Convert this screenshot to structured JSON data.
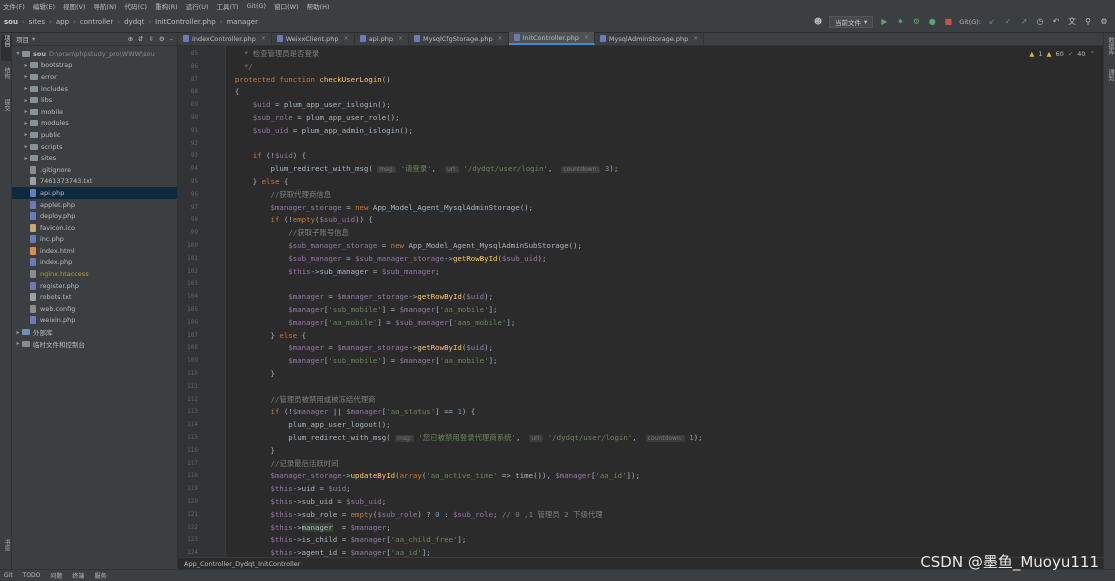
{
  "menu": [
    "文件(F)",
    "编辑(E)",
    "视图(V)",
    "导航(N)",
    "代码(C)",
    "重构(R)",
    "运行(U)",
    "工具(T)",
    "Git(G)",
    "窗口(W)",
    "帮助(H)"
  ],
  "breadcrumb": [
    "sou",
    "sites",
    "app",
    "controller",
    "dydqt",
    "InitController.php",
    "manager"
  ],
  "toolbar": {
    "run_config": "当前文件",
    "git_label": "Git(G):"
  },
  "left_strip": [
    "项目",
    "结构",
    "提交"
  ],
  "left_strip_bottom": "书签",
  "project_panel": {
    "title": "项目",
    "root": "sou",
    "root_path": "D:\\oran\\phpstudy_pro\\WWW\\sou",
    "items": [
      {
        "name": "bootstrap",
        "kind": "folder"
      },
      {
        "name": "error",
        "kind": "folder"
      },
      {
        "name": "includes",
        "kind": "folder"
      },
      {
        "name": "libs",
        "kind": "folder"
      },
      {
        "name": "mobile",
        "kind": "folder"
      },
      {
        "name": "modules",
        "kind": "folder"
      },
      {
        "name": "public",
        "kind": "folder"
      },
      {
        "name": "scripts",
        "kind": "folder"
      },
      {
        "name": "sites",
        "kind": "folder"
      },
      {
        "name": ".gitignore",
        "kind": "gen"
      },
      {
        "name": "7461373743.txt",
        "kind": "txt"
      },
      {
        "name": "api.php",
        "kind": "php",
        "selected": true
      },
      {
        "name": "applet.php",
        "kind": "php"
      },
      {
        "name": "deploy.php",
        "kind": "php"
      },
      {
        "name": "favicon.ico",
        "kind": "ico"
      },
      {
        "name": "inc.php",
        "kind": "php"
      },
      {
        "name": "index.html",
        "kind": "html"
      },
      {
        "name": "index.php",
        "kind": "php"
      },
      {
        "name": "nginx.htaccess",
        "kind": "gen",
        "ignored": true
      },
      {
        "name": "register.php",
        "kind": "php"
      },
      {
        "name": "robots.txt",
        "kind": "txt"
      },
      {
        "name": "web.config",
        "kind": "gen"
      },
      {
        "name": "weixin.php",
        "kind": "php"
      }
    ],
    "external_libs": "外部库",
    "scratches": "临时文件和控制台"
  },
  "tabs": [
    {
      "label": "IndexController.php",
      "active": false
    },
    {
      "label": "WeixxClient.php",
      "active": false
    },
    {
      "label": "api.php",
      "active": false
    },
    {
      "label": "MysqlCfgStorage.php",
      "active": false
    },
    {
      "label": "InitController.php",
      "active": true
    },
    {
      "label": "MysqlAdminStorage.php",
      "active": false
    }
  ],
  "inspections": {
    "warnings": "1",
    "weak": "60",
    "ok": "40"
  },
  "code_lines": [
    {
      "n": "85",
      "html": "    <span class='cmt'>* 检查管理员是否登录</span>"
    },
    {
      "n": "86",
      "html": "    <span class='cmt'>*/</span>"
    },
    {
      "n": "87",
      "html": "  <span class='kw'>protected function</span> <span class='fn'>checkUserLogin</span>()"
    },
    {
      "n": "88",
      "html": "  {"
    },
    {
      "n": "89",
      "html": "      <span class='var'>$uid</span> = plum_app_user_islogin();"
    },
    {
      "n": "90",
      "html": "      <span class='var'>$sub_role</span> = plum_app_user_role();"
    },
    {
      "n": "91",
      "html": "      <span class='var'>$sub_uid</span> = plum_app_admin_islogin();"
    },
    {
      "n": "92",
      "html": ""
    },
    {
      "n": "93",
      "html": "      <span class='kw'>if</span> (!<span class='var'>$uid</span>) {"
    },
    {
      "n": "94",
      "html": "          plum_redirect_with_msg( <span class='hint'>msg:</span> <span class='str'>'请登录'</span>,  <span class='hint'>url:</span> <span class='str'>'/dydqt/user/login'</span>,  <span class='hint'>countdown:</span> <span class='num'>3</span>);"
    },
    {
      "n": "95",
      "html": "      } <span class='kw'>else</span> {"
    },
    {
      "n": "96",
      "html": "          <span class='cmt'>//获取代理商信息</span>"
    },
    {
      "n": "97",
      "html": "          <span class='var'>$manager_storage</span> = <span class='kw'>new</span> App_Model_Agent_MysqlAdminStorage();"
    },
    {
      "n": "98",
      "html": "          <span class='kw'>if</span> (!<span class='kw'>empty</span>(<span class='var'>$sub_uid</span>)) {"
    },
    {
      "n": "99",
      "html": "              <span class='cmt'>//获取子账号信息</span>"
    },
    {
      "n": "100",
      "html": "              <span class='var'>$sub_manager_storage</span> = <span class='kw'>new</span> App_Model_Agent_MysqlAdminSubStorage();"
    },
    {
      "n": "101",
      "html": "              <span class='var'>$sub_manager</span> = <span class='var'>$sub_manager_storage</span>-><span class='fn'>getRowById</span>(<span class='var'>$sub_uid</span>);"
    },
    {
      "n": "102",
      "html": "              <span class='var'>$this</span>->sub_manager = <span class='var'>$sub_manager</span>;"
    },
    {
      "n": "103",
      "html": ""
    },
    {
      "n": "104",
      "html": "              <span class='var'>$manager</span> = <span class='var'>$manager_storage</span>-><span class='fn'>getRowById</span>(<span class='var'>$uid</span>);"
    },
    {
      "n": "105",
      "html": "              <span class='var'>$manager</span>[<span class='str'>'sub_mobile'</span>] = <span class='var'>$manager</span>[<span class='str'>'aa_mobile'</span>];"
    },
    {
      "n": "106",
      "html": "              <span class='var'>$manager</span>[<span class='str'>'aa_mobile'</span>] = <span class='var'>$sub_manager</span>[<span class='str'>'aas_mobile'</span>];"
    },
    {
      "n": "107",
      "html": "          } <span class='kw'>else</span> {"
    },
    {
      "n": "108",
      "html": "              <span class='var'>$manager</span> = <span class='var'>$manager_storage</span>-><span class='fn'>getRowById</span>(<span class='var'>$uid</span>);"
    },
    {
      "n": "109",
      "html": "              <span class='var'>$manager</span>[<span class='str'>'sub_mobile'</span>] = <span class='var'>$manager</span>[<span class='str'>'aa_mobile'</span>];"
    },
    {
      "n": "110",
      "html": "          }"
    },
    {
      "n": "111",
      "html": ""
    },
    {
      "n": "112",
      "html": "          <span class='cmt'>//管理员被禁用或被冻结代理商</span>"
    },
    {
      "n": "113",
      "html": "          <span class='kw'>if</span> (!<span class='var'>$manager</span> || <span class='var'>$manager</span>[<span class='str'>'aa_status'</span>] == <span class='num'>1</span>) {"
    },
    {
      "n": "114",
      "html": "              plum_app_user_logout();"
    },
    {
      "n": "115",
      "html": "              plum_redirect_with_msg( <span class='hint'>msg:</span> <span class='str'>'您已被禁用登录代理商系统'</span>,  <span class='hint'>url:</span> <span class='str'>'/dydqt/user/login'</span>,  <span class='hint'>countdown:</span> <span class='num'>1</span>);"
    },
    {
      "n": "116",
      "html": "          }"
    },
    {
      "n": "117",
      "html": "          <span class='cmt'>//记录最后活跃时间</span>"
    },
    {
      "n": "118",
      "html": "          <span class='var'>$manager_storage</span>-><span class='fn'>updateById</span>(<span class='kw'>array</span>(<span class='str'>'aa_active_time'</span> => time()), <span class='var'>$manager</span>[<span class='str'>'aa_id'</span>]);"
    },
    {
      "n": "119",
      "html": "          <span class='var'>$this</span>->uid = <span class='var'>$uid</span>;"
    },
    {
      "n": "120",
      "html": "          <span class='var'>$this</span>->sub_uid = <span class='var'>$sub_uid</span>;"
    },
    {
      "n": "121",
      "html": "          <span class='var'>$this</span>->sub_role = <span class='kw'>empty</span>(<span class='var'>$sub_role</span>) ? <span class='num'>0</span> : <span class='var'>$sub_role</span>; <span class='cmt'>// 0 ,1 管理员 2 下级代理</span>"
    },
    {
      "n": "122",
      "html": "          <span class='var'>$this</span>-><span class='hl'>manager</span>  = <span class='var'>$manager</span>;"
    },
    {
      "n": "123",
      "html": "          <span class='var'>$this</span>->is_child = <span class='var'>$manager</span>[<span class='str'>'aa_child_free'</span>];"
    },
    {
      "n": "124",
      "html": "          <span class='var'>$this</span>->agent_id = <span class='var'>$manager</span>[<span class='str'>'aa_id'</span>];"
    }
  ],
  "editor_crumb": "App_Controller_Dydqt_InitController",
  "bottom_tools": [
    "Git",
    "TODO",
    "问题",
    "终端",
    "服务"
  ],
  "watermark": "CSDN @墨鱼_Muoyu111"
}
